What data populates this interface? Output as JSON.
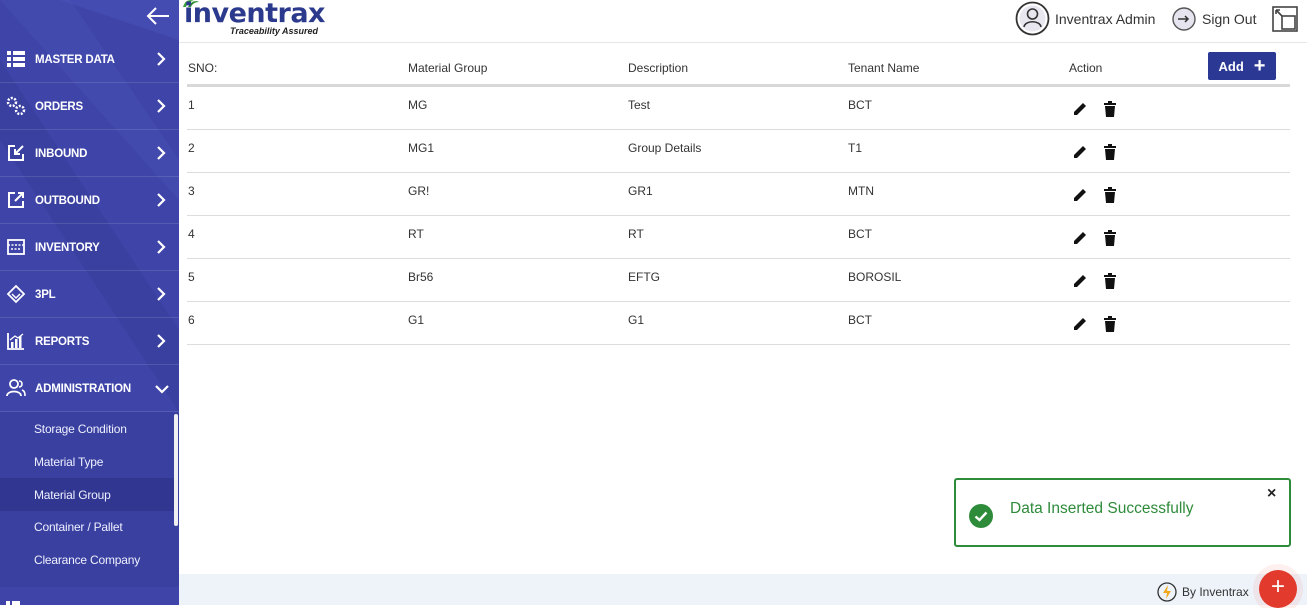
{
  "sidebar": {
    "items": [
      {
        "label": "MASTER DATA",
        "icon": "list-icon"
      },
      {
        "label": "ORDERS",
        "icon": "gears-icon"
      },
      {
        "label": "INBOUND",
        "icon": "inbound-icon"
      },
      {
        "label": "OUTBOUND",
        "icon": "outbound-icon"
      },
      {
        "label": "INVENTORY",
        "icon": "inventory-icon"
      },
      {
        "label": "3PL",
        "icon": "diamond-icon"
      },
      {
        "label": "REPORTS",
        "icon": "chart-icon"
      },
      {
        "label": "ADMINISTRATION",
        "icon": "users-icon"
      }
    ],
    "subitems": [
      {
        "label": "Storage Condition"
      },
      {
        "label": "Material Type"
      },
      {
        "label": "Material Group"
      },
      {
        "label": "Container / Pallet"
      },
      {
        "label": "Clearance Company"
      }
    ],
    "active_subitem": "Material Group"
  },
  "header": {
    "brand": "inventrax",
    "tagline": "Traceability Assured",
    "user_name": "Inventrax Admin",
    "signout_label": "Sign Out"
  },
  "table": {
    "columns": [
      "SNO:",
      "Material Group",
      "Description",
      "Tenant Name",
      "Action"
    ],
    "add_label": "Add",
    "rows": [
      {
        "sno": "1",
        "group": "MG",
        "description": "Test",
        "tenant": "BCT"
      },
      {
        "sno": "2",
        "group": "MG1",
        "description": "Group Details",
        "tenant": "T1"
      },
      {
        "sno": "3",
        "group": "GR!",
        "description": "GR1",
        "tenant": "MTN"
      },
      {
        "sno": "4",
        "group": "RT",
        "description": "RT",
        "tenant": "BCT"
      },
      {
        "sno": "5",
        "group": "Br56",
        "description": "EFTG",
        "tenant": "BOROSIL"
      },
      {
        "sno": "6",
        "group": "G1",
        "description": "G1",
        "tenant": "BCT"
      }
    ]
  },
  "toast": {
    "message": "Data Inserted Successfully",
    "close": "×"
  },
  "footer": {
    "by_label": "By Inventrax"
  },
  "fab": {
    "symbol": "+"
  },
  "colors": {
    "sidebar": "#3f45a8",
    "primary_button": "#2b3894",
    "success": "#2e8b3a",
    "fab": "#e23a2c"
  }
}
